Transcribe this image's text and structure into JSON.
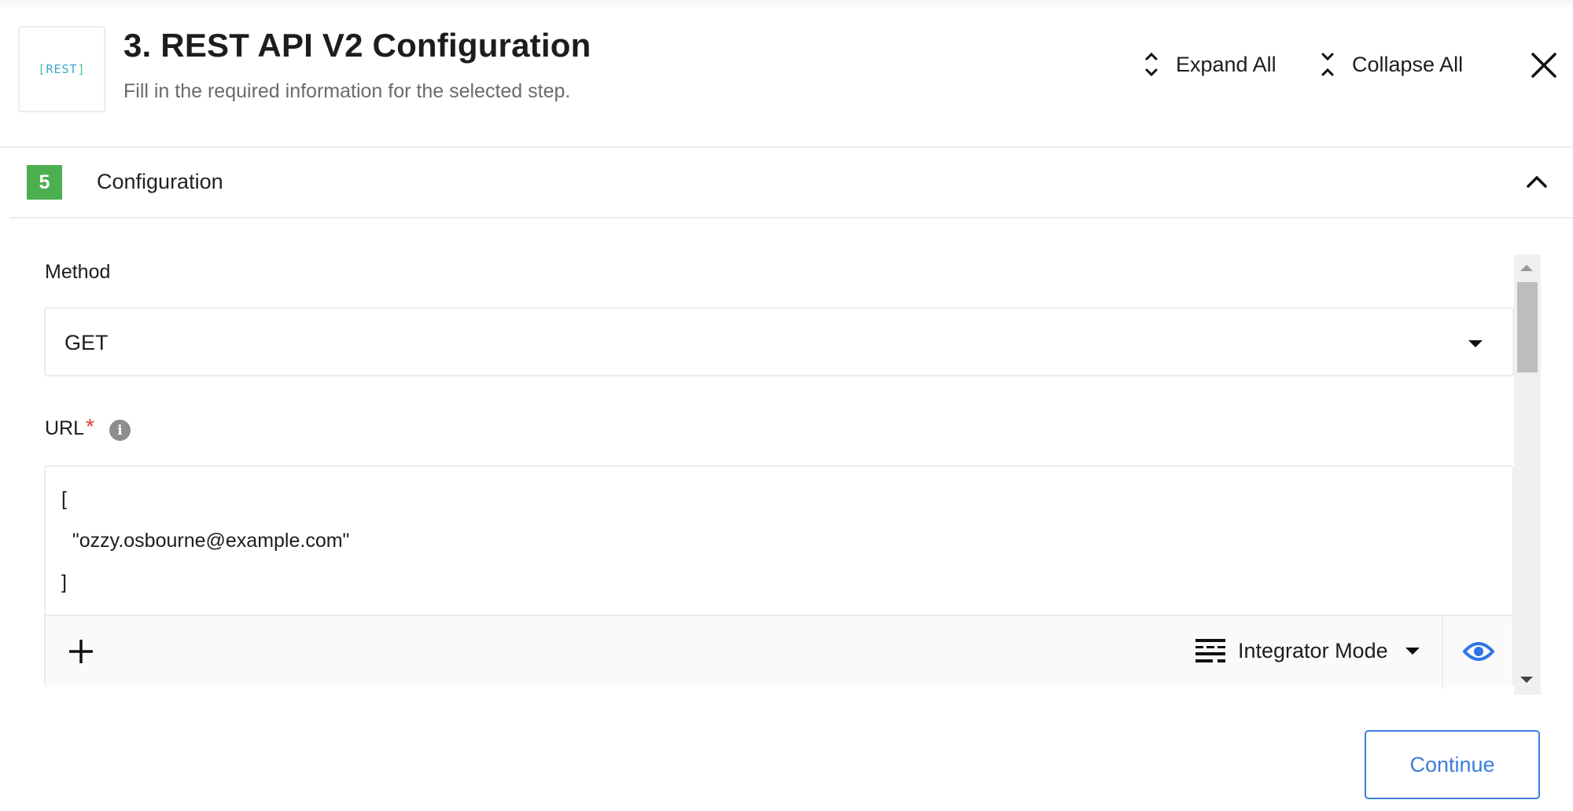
{
  "header": {
    "logo_text": "REST",
    "title": "3. REST API V2 Configuration",
    "subtitle": "Fill in the required information for the selected step.",
    "expand_all_label": "Expand All",
    "collapse_all_label": "Collapse All",
    "close_icon": "close-icon"
  },
  "section": {
    "step_number": "5",
    "title": "Configuration",
    "expanded": true,
    "badge_color": "#4caf50"
  },
  "form": {
    "method": {
      "label": "Method",
      "selected_value": "GET"
    },
    "url": {
      "label": "URL",
      "required_marker": "*",
      "info_icon_glyph": "i",
      "value_lines": [
        "[",
        "  \"ozzy.osbourne@example.com\"",
        "]"
      ],
      "toolbar": {
        "add_icon": "plus-icon",
        "mode_label": "Integrator Mode",
        "preview_icon": "eye-icon"
      }
    }
  },
  "actions": {
    "continue_label": "Continue"
  },
  "colors": {
    "accent": "#3b7ddd",
    "required": "#e53935",
    "eye_icon": "#2f74e8"
  }
}
